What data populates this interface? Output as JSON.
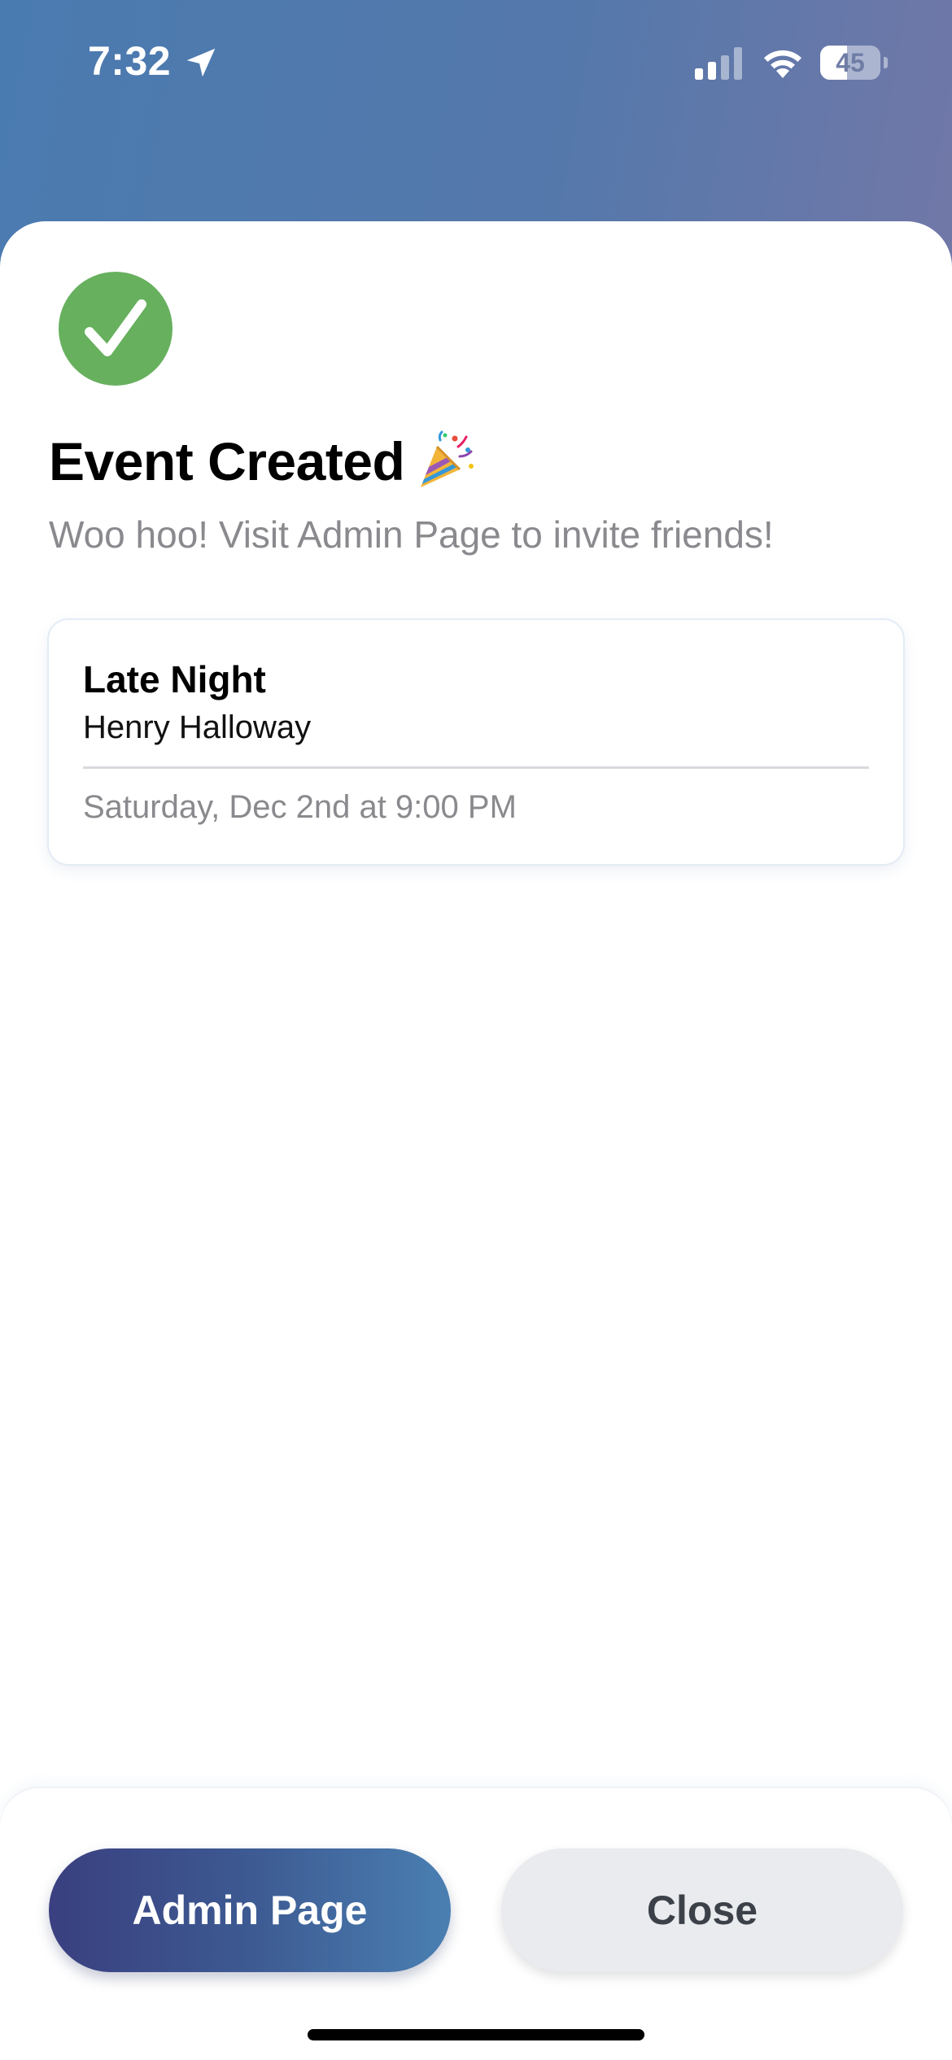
{
  "status_bar": {
    "time": "7:32",
    "battery_level": "45",
    "battery_fraction": 0.45,
    "icons": [
      "location-arrow-icon",
      "cellular-signal-icon",
      "wifi-icon",
      "battery-icon"
    ]
  },
  "header": {
    "title": "Event Created",
    "title_emoji_icon": "party-popper-icon",
    "subtitle": "Woo hoo! Visit Admin Page to invite friends!"
  },
  "event": {
    "name": "Late Night",
    "host": "Henry Halloway",
    "datetime": "Saturday, Dec 2nd at 9:00 PM"
  },
  "actions": {
    "admin_label": "Admin Page",
    "close_label": "Close"
  },
  "colors": {
    "success_green": "#67b05e",
    "primary_gradient_start": "#3a3f80",
    "primary_gradient_end": "#4a7fb2",
    "secondary_button": "#e9ebee",
    "muted_text": "#8a8a8e"
  }
}
